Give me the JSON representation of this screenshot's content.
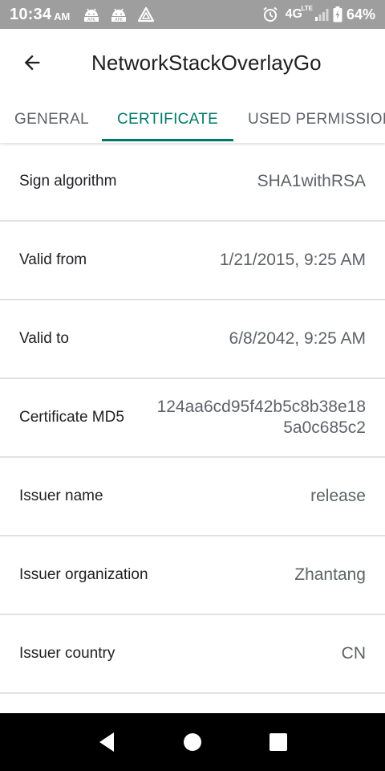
{
  "status_bar": {
    "time": "10:34",
    "ampm": "AM",
    "network": "4G",
    "network_sub": "LTE",
    "battery": "64%",
    "icons": [
      "android-apk-icon",
      "android-apk-icon",
      "triangle-drive-icon",
      "alarm-icon",
      "signal-icon",
      "battery-icon"
    ]
  },
  "app_bar": {
    "title": "NetworkStackOverlayGo",
    "back_icon": "arrow-back-icon"
  },
  "tabs": [
    {
      "label": "GENERAL",
      "active": false
    },
    {
      "label": "CERTIFICATE",
      "active": true
    },
    {
      "label": "USED PERMISSIONS",
      "active": false
    }
  ],
  "accent_color": "#00796b",
  "rows": [
    {
      "label": "Sign algorithm",
      "value": "SHA1withRSA"
    },
    {
      "label": "Valid from",
      "value": "1/21/2015, 9:25 AM"
    },
    {
      "label": "Valid to",
      "value": "6/8/2042, 9:25 AM"
    },
    {
      "label": "Certificate MD5",
      "value": "124aa6cd95f42b5c8b38e185a0c685c2"
    },
    {
      "label": "Issuer name",
      "value": "release"
    },
    {
      "label": "Issuer organization",
      "value": "Zhantang"
    },
    {
      "label": "Issuer country",
      "value": "CN"
    }
  ],
  "nav_bar": {
    "buttons": [
      "back-triangle-icon",
      "home-circle-icon",
      "recents-square-icon"
    ]
  }
}
